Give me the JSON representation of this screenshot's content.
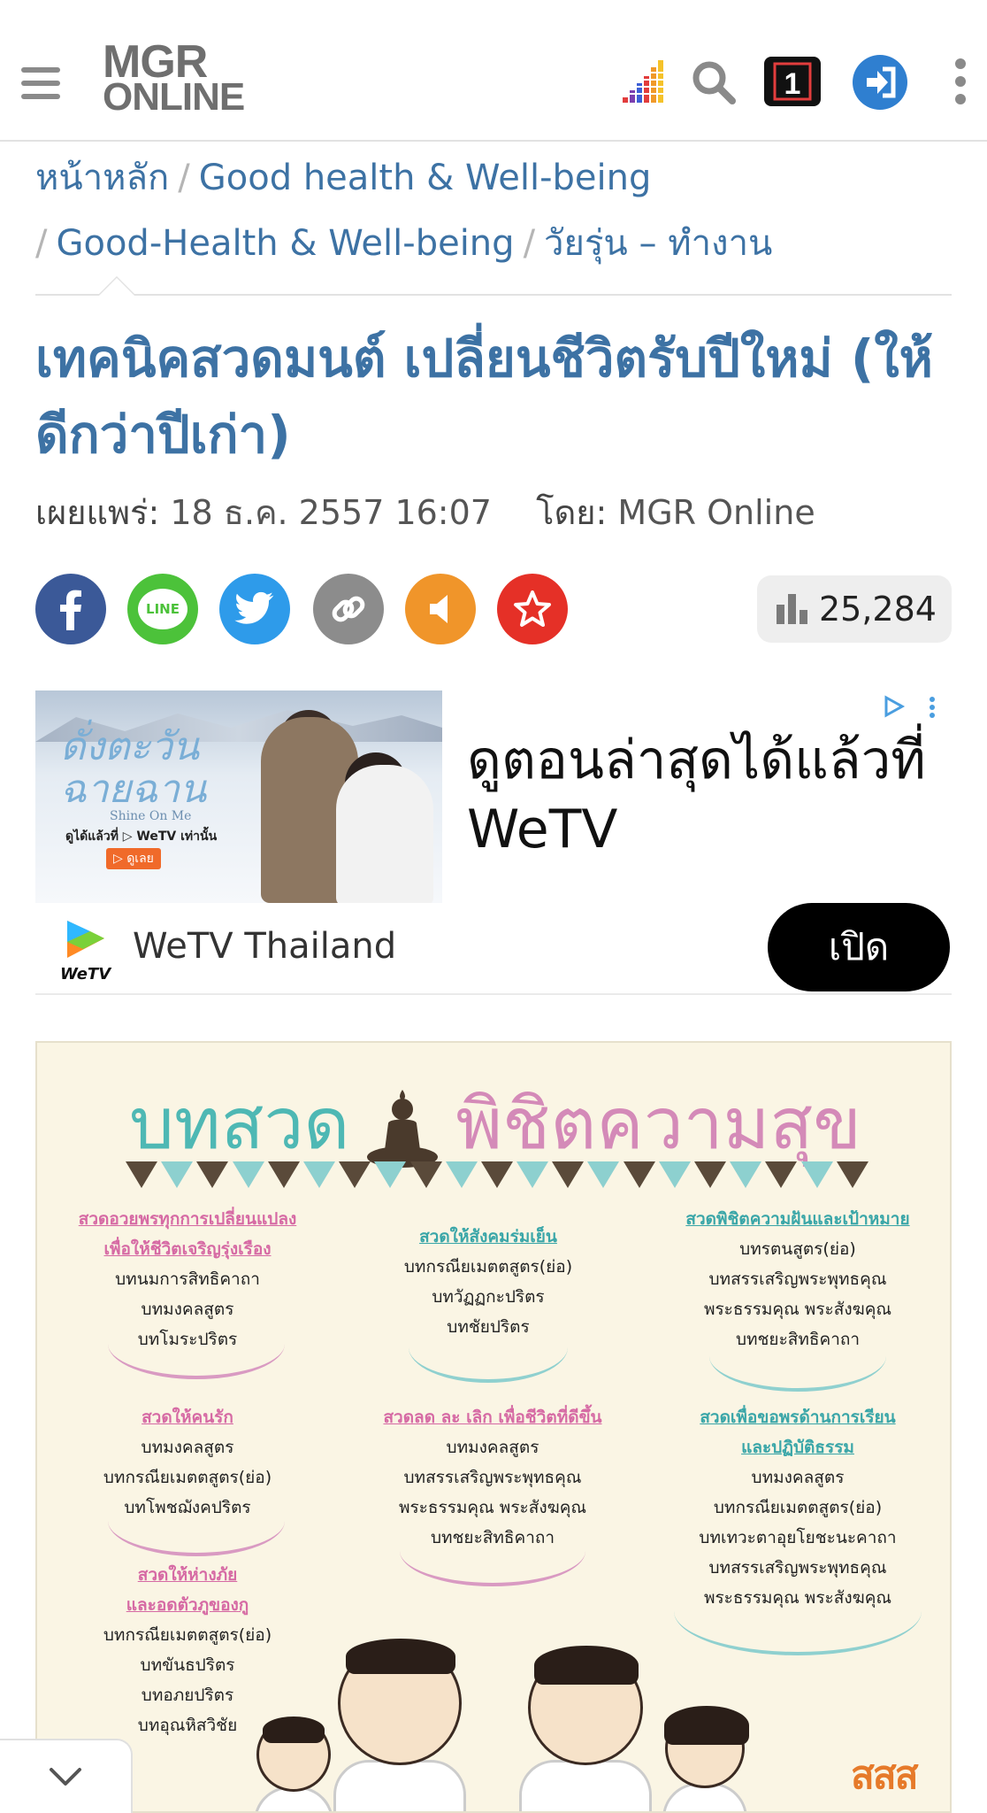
{
  "header": {
    "logo_line1": "MGR",
    "logo_line2": "ONLINE",
    "icons": [
      "menu-icon",
      "podcast-bars-icon",
      "search-icon",
      "one-icon",
      "login-icon",
      "more-vertical-icon"
    ]
  },
  "breadcrumb": {
    "items": [
      "หน้าหลัก",
      "Good health & Well-being",
      "Good-Health & Well-being",
      "วัยรุ่น – ทำงาน"
    ],
    "separator": "/"
  },
  "article": {
    "title": "เทคนิคสวดมนต์ เปลี่ยนชีวิตรับปีใหม่ (ให้ดีกว่าปีเก่า)",
    "published_label": "เผยแพร่:",
    "published_value": "18 ธ.ค. 2557 16:07",
    "author_label": "โดย:",
    "author_value": "MGR Online",
    "view_count": "25,284"
  },
  "share": {
    "buttons": [
      "facebook-share-icon",
      "line-share-icon",
      "twitter-share-icon",
      "copy-link-icon",
      "announce-icon",
      "favorite-star-icon"
    ],
    "line_label": "LINE"
  },
  "ad": {
    "image_title": "ดั่งตะวันฉายฉาน",
    "image_subtitle": "Shine On Me",
    "image_watch_text": "ดูได้แล้วที่ ▷ WeTV เท่านั้น",
    "image_cta": "▷ ดูเลย",
    "headline": "ดูตอนล่าสุดได้แล้วที่ WeTV",
    "advertiser": "WeTV Thailand",
    "advertiser_logo_text": "WeTV",
    "open_button": "เปิด"
  },
  "infographic": {
    "title_part1": "บทสวด",
    "title_part2": "พิชิตความสุข",
    "columns": [
      {
        "heading": [
          "สวดอวยพรทุกการเปลี่ยนแปลง",
          "เพื่อให้ชีวิตเจริญรุ่งเรือง"
        ],
        "items": [
          "บทนมการสิทธิคาถา",
          "บทมงคลสูตร",
          "บทโมระปริตร"
        ]
      },
      {
        "heading": [
          "สวดให้สังคมร่มเย็น"
        ],
        "items": [
          "บทกรณียเมตตสูตร(ย่อ)",
          "บทวัฏฏกะปริตร",
          "บทชัยปริตร"
        ]
      },
      {
        "heading": [
          "สวดพิชิตความฝันและเป้าหมาย"
        ],
        "items": [
          "บทรตนสูตร(ย่อ)",
          "บทสรรเสริญพระพุทธคุณ",
          "พระธรรมคุณ พระสังฆคุณ",
          "บทชยะสิทธิคาถา"
        ]
      },
      {
        "heading": [
          "สวดให้คนรัก"
        ],
        "items": [
          "บทมงคลสูตร",
          "บทกรณียเมตตสูตร(ย่อ)",
          "บทโพชฌังคปริตร"
        ]
      },
      {
        "heading": [
          "สวดลด ละ เลิก เพื่อชีวิตที่ดีขึ้น"
        ],
        "items": [
          "บทมงคลสูตร",
          "บทสรรเสริญพระพุทธคุณ",
          "พระธรรมคุณ พระสังฆคุณ",
          "บทชยะสิทธิคาถา"
        ]
      },
      {
        "heading": [
          "สวดเพื่อขอพรด้านการเรียน",
          "และปฏิบัติธรรม"
        ],
        "items": [
          "บทมงคลสูตร",
          "บทกรณียเมตตสูตร(ย่อ)",
          "บทเทวะตาอุยโยชะนะคาถา",
          "บทสรรเสริญพระพุทธคุณ",
          "พระธรรมคุณ พระสังฆคุณ"
        ]
      },
      {
        "heading": [
          "สวดให้ห่างภัย",
          "และอดตัวภูของกู"
        ],
        "items": [
          "บทกรณียเมตตสูตร(ย่อ)",
          "บทขันธปริตร",
          "บทอภยปริตร",
          "บทอุณหิสวิชัย"
        ]
      }
    ],
    "logo_text": "สสส"
  },
  "colors": {
    "link_blue": "#3d72a4",
    "facebook": "#3b5998",
    "line": "#4cc23a",
    "twitter": "#2e9bea",
    "link_gray": "#8c8c8c",
    "announce": "#f0952a",
    "favorite": "#e53027",
    "info_teal": "#4eb8b4",
    "info_pink": "#d48ab8"
  }
}
